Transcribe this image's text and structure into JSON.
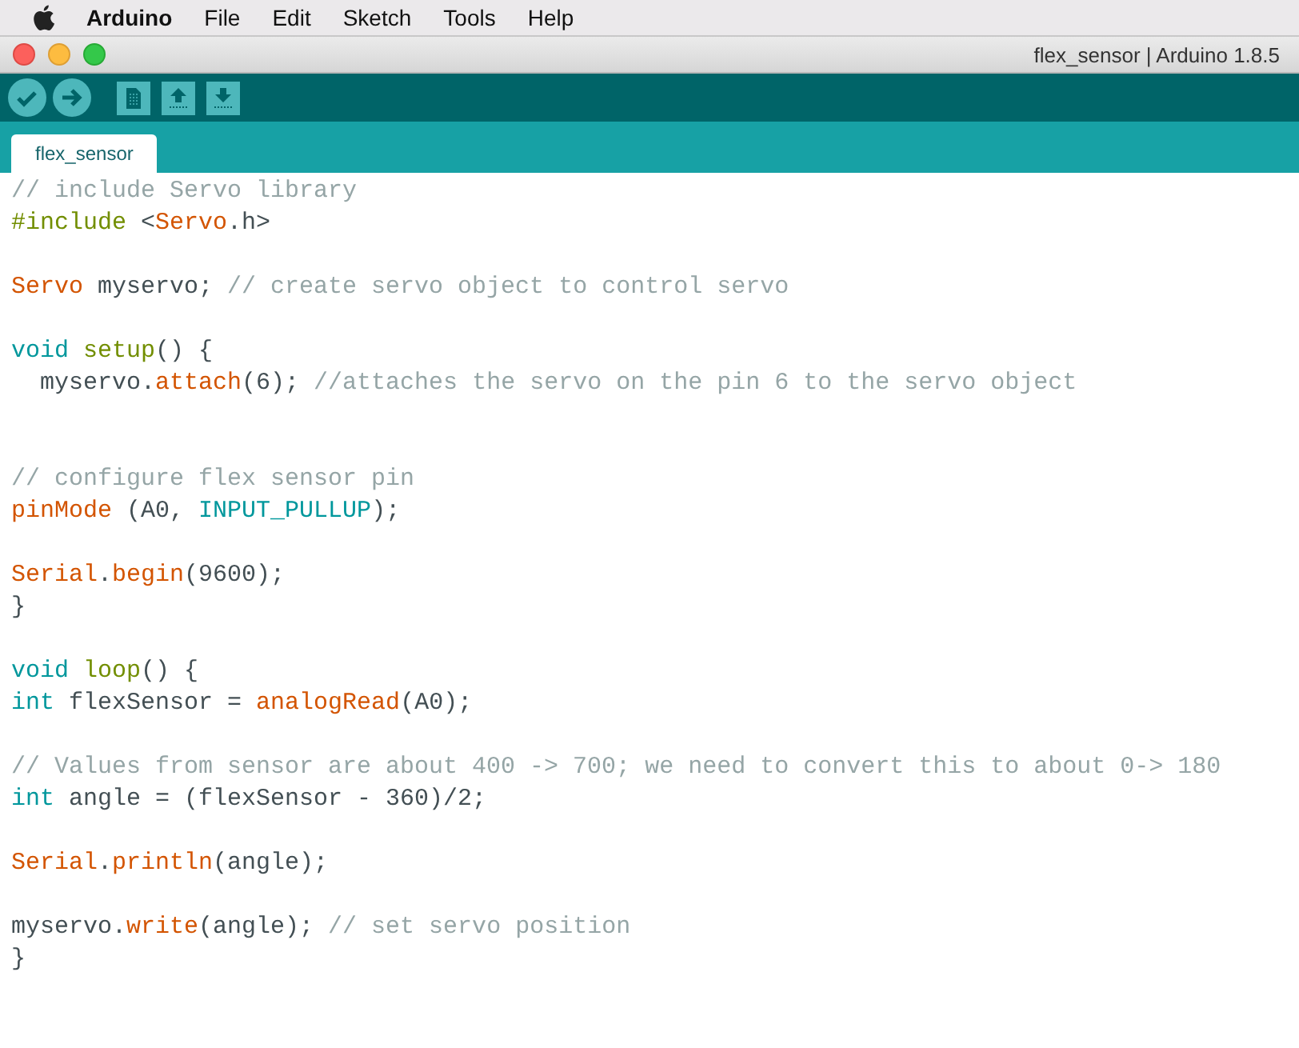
{
  "menu_bar": {
    "app": "Arduino",
    "items": [
      "File",
      "Edit",
      "Sketch",
      "Tools",
      "Help"
    ]
  },
  "window": {
    "title": "flex_sensor | Arduino 1.8.5"
  },
  "tabs": [
    {
      "label": "flex_sensor",
      "selected": true
    }
  ],
  "code_lines": [
    {
      "kind": "code",
      "tokens": [
        {
          "kind": "comment",
          "text": "// include Servo library"
        }
      ]
    },
    {
      "kind": "code",
      "tokens": [
        {
          "kind": "structure",
          "text": "#include"
        },
        {
          "kind": "plain",
          "text": " <"
        },
        {
          "kind": "function",
          "text": "Servo"
        },
        {
          "kind": "plain",
          "text": ".h>"
        }
      ]
    },
    {
      "kind": "blank"
    },
    {
      "kind": "code",
      "tokens": [
        {
          "kind": "function",
          "text": "Servo"
        },
        {
          "kind": "plain",
          "text": " myservo; "
        },
        {
          "kind": "comment",
          "text": "// create servo object to control servo"
        }
      ]
    },
    {
      "kind": "blank"
    },
    {
      "kind": "code",
      "tokens": [
        {
          "kind": "keyword",
          "text": "void "
        },
        {
          "kind": "structure",
          "text": "setup"
        },
        {
          "kind": "plain",
          "text": "() {"
        }
      ]
    },
    {
      "kind": "code",
      "tokens": [
        {
          "kind": "plain",
          "text": "  myservo."
        },
        {
          "kind": "function",
          "text": "attach"
        },
        {
          "kind": "plain",
          "text": "(6); "
        },
        {
          "kind": "comment",
          "text": "//attaches the servo on the pin 6 to the servo object"
        }
      ]
    },
    {
      "kind": "blank"
    },
    {
      "kind": "blank"
    },
    {
      "kind": "code",
      "tokens": [
        {
          "kind": "comment",
          "text": "// configure flex sensor pin"
        }
      ]
    },
    {
      "kind": "code",
      "tokens": [
        {
          "kind": "function",
          "text": "pinMode"
        },
        {
          "kind": "plain",
          "text": " (A0, "
        },
        {
          "kind": "keyword",
          "text": "INPUT_PULLUP"
        },
        {
          "kind": "plain",
          "text": ");"
        }
      ]
    },
    {
      "kind": "blank"
    },
    {
      "kind": "code",
      "tokens": [
        {
          "kind": "function",
          "text": "Serial"
        },
        {
          "kind": "plain",
          "text": "."
        },
        {
          "kind": "function",
          "text": "begin"
        },
        {
          "kind": "plain",
          "text": "(9600);"
        }
      ]
    },
    {
      "kind": "code",
      "tokens": [
        {
          "kind": "plain",
          "text": "}"
        }
      ]
    },
    {
      "kind": "blank"
    },
    {
      "kind": "code",
      "tokens": [
        {
          "kind": "keyword",
          "text": "void "
        },
        {
          "kind": "structure",
          "text": "loop"
        },
        {
          "kind": "plain",
          "text": "() {"
        }
      ]
    },
    {
      "kind": "code",
      "tokens": [
        {
          "kind": "keyword",
          "text": "int"
        },
        {
          "kind": "plain",
          "text": " flexSensor = "
        },
        {
          "kind": "function",
          "text": "analogRead"
        },
        {
          "kind": "plain",
          "text": "(A0);"
        }
      ]
    },
    {
      "kind": "blank"
    },
    {
      "kind": "code",
      "tokens": [
        {
          "kind": "comment",
          "text": "// Values from sensor are about 400 -> 700; we need to convert this to about 0-> 180"
        }
      ]
    },
    {
      "kind": "code",
      "tokens": [
        {
          "kind": "keyword",
          "text": "int"
        },
        {
          "kind": "plain",
          "text": " angle = (flexSensor - 360)/2;"
        }
      ]
    },
    {
      "kind": "blank"
    },
    {
      "kind": "code",
      "tokens": [
        {
          "kind": "function",
          "text": "Serial"
        },
        {
          "kind": "plain",
          "text": "."
        },
        {
          "kind": "function",
          "text": "println"
        },
        {
          "kind": "plain",
          "text": "(angle);"
        }
      ]
    },
    {
      "kind": "blank"
    },
    {
      "kind": "code",
      "tokens": [
        {
          "kind": "plain",
          "text": "myservo."
        },
        {
          "kind": "function",
          "text": "write"
        },
        {
          "kind": "plain",
          "text": "(angle); "
        },
        {
          "kind": "comment",
          "text": "// set servo position"
        }
      ]
    },
    {
      "kind": "code",
      "tokens": [
        {
          "kind": "plain",
          "text": "}"
        }
      ]
    }
  ]
}
